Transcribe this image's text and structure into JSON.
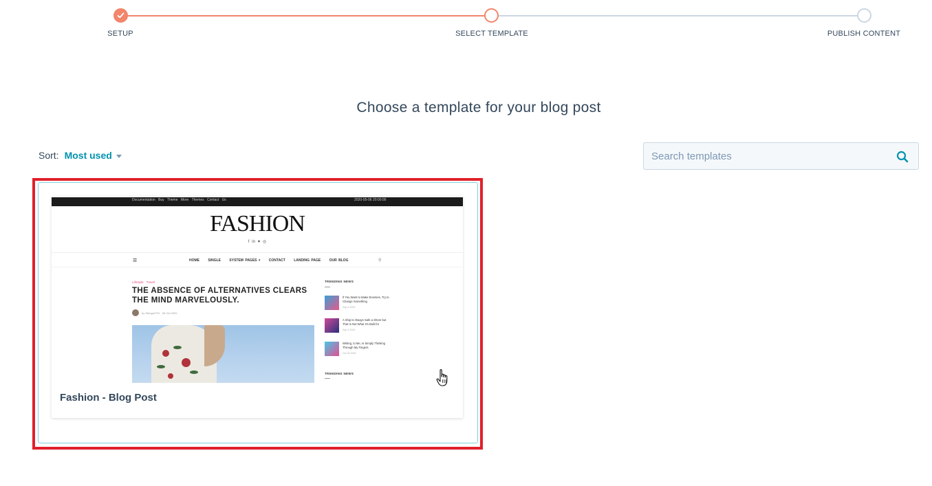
{
  "stepper": {
    "steps": [
      {
        "label": "SETUP",
        "state": "complete"
      },
      {
        "label": "SELECT TEMPLATE",
        "state": "current"
      },
      {
        "label": "PUBLISH CONTENT",
        "state": "future"
      }
    ],
    "accent_color": "#f2856b",
    "inactive_color": "#cbd6e2"
  },
  "page": {
    "title": "Choose a template for your blog post"
  },
  "sort": {
    "label": "Sort:",
    "value": "Most used"
  },
  "search": {
    "placeholder": "Search templates",
    "value": "",
    "icon": "search-icon"
  },
  "templates": [
    {
      "name": "Fashion - Blog Post",
      "preview": {
        "top_links": "Documentation Buy Theme More Themes Contact Us",
        "top_date": "2020-05-06 20:00:00",
        "logo": "FASHION",
        "social": "f in ♥ ◎",
        "nav": [
          "HOME",
          "SINGLE",
          "SYSTEM PAGES ▾",
          "CONTACT",
          "LANDING PAGE",
          "OUR BLOG"
        ],
        "categories": "Lifestyle Travel",
        "headline": "THE ABSENCE OF ALTERNATIVES CLEARS THE MIND MARVELOUSLY.",
        "author_line": "by StringsOTD · 06 Oct 2020",
        "sidebar_title": "TRENDING NEWS",
        "sidebar_items": [
          {
            "text": "If You Want to Make Enemies, Try to Change Something",
            "date": "Sep 4 2020"
          },
          {
            "text": "A Ship Is Always Safe a Shore but That Is Not What It's Built for",
            "date": "Sep 4 2020"
          },
          {
            "text": "Writing, to Me, Is Simply Thinking Through My Fingers",
            "date": "Oct 30 2020"
          }
        ],
        "sidebar_title_2": "TRENDING NEWS"
      }
    }
  ],
  "colors": {
    "highlight_border": "#e0202a",
    "tile_border": "#7fd1de",
    "link": "#0091ae",
    "text": "#33475b"
  }
}
